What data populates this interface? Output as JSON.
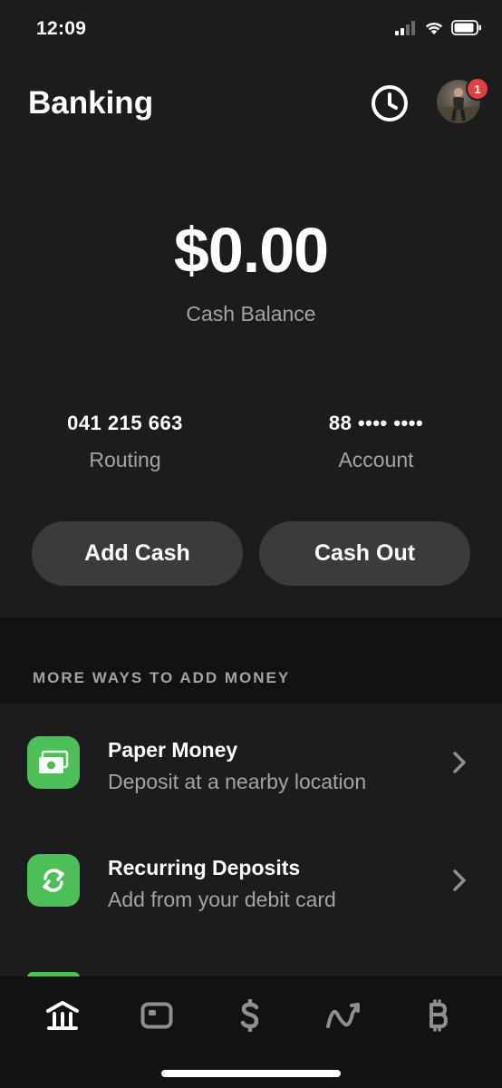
{
  "status_bar": {
    "time": "12:09"
  },
  "header": {
    "title": "Banking",
    "notification_count": "1"
  },
  "balance": {
    "amount": "$0.00",
    "label": "Cash Balance"
  },
  "routing": {
    "value": "041 215 663",
    "label": "Routing"
  },
  "account": {
    "value": "88 •••• ••••",
    "label": "Account"
  },
  "actions": {
    "add_cash": "Add Cash",
    "cash_out": "Cash Out"
  },
  "section": {
    "title": "MORE WAYS TO ADD MONEY"
  },
  "list": [
    {
      "title": "Paper Money",
      "subtitle": "Deposit at a nearby location",
      "icon": "banknote-icon"
    },
    {
      "title": "Recurring Deposits",
      "subtitle": "Add from your debit card",
      "icon": "refresh-icon"
    }
  ],
  "tabs": [
    {
      "icon": "bank-icon",
      "active": true
    },
    {
      "icon": "card-icon",
      "active": false
    },
    {
      "icon": "dollar-icon",
      "active": false
    },
    {
      "icon": "investing-icon",
      "active": false
    },
    {
      "icon": "bitcoin-icon",
      "active": false
    }
  ],
  "colors": {
    "background": "#1c1c1e",
    "section_band": "#121212",
    "button": "#3b3b3e",
    "accent_green": "#4cc057",
    "badge_red": "#e0413f",
    "secondary_text": "#a3a3a8"
  }
}
